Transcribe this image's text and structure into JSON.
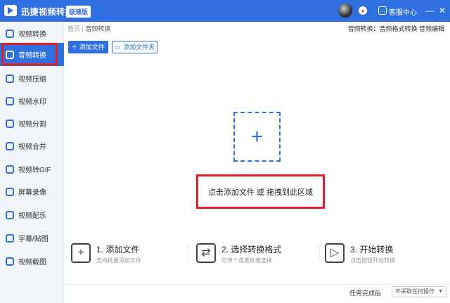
{
  "app": {
    "title": "迅捷视频转换器",
    "edition": "极速版"
  },
  "titlebar": {
    "help_label": "客服中心",
    "minimize": "—",
    "close": "✕"
  },
  "sidebar": {
    "items": [
      {
        "label": "视频转换"
      },
      {
        "label": "音频转换"
      },
      {
        "label": "视频压缩"
      },
      {
        "label": "视频水印"
      },
      {
        "label": "视频分割"
      },
      {
        "label": "视频合并"
      },
      {
        "label": "视频转GIF"
      },
      {
        "label": "屏幕录像"
      },
      {
        "label": "视频配乐"
      },
      {
        "label": "字幕/贴图"
      },
      {
        "label": "视频截图"
      }
    ],
    "active_index": 1
  },
  "breadcrumb": {
    "home": "首页",
    "separator": "|",
    "current": "音频转换"
  },
  "top_links": "音频转换：音频格式转换 音频编辑",
  "toolbar": {
    "add_file": "添加文件",
    "add_folder": "添加文件夹"
  },
  "drop_zone": {
    "text": "点击添加文件 或 拖拽到此区域"
  },
  "steps": [
    {
      "title": "1. 添加文件",
      "desc": "支持批量添加文件"
    },
    {
      "title": "2. 选择转换格式",
      "desc": "可单个或者批量选择"
    },
    {
      "title": "3. 开始转换",
      "desc": "点击按钮开始转换"
    }
  ],
  "footer": {
    "done_label": "任务完成后",
    "done_option": "不采取任何操作"
  },
  "colors": {
    "brand": "#2f6fe0",
    "highlight": "#e0202a"
  }
}
